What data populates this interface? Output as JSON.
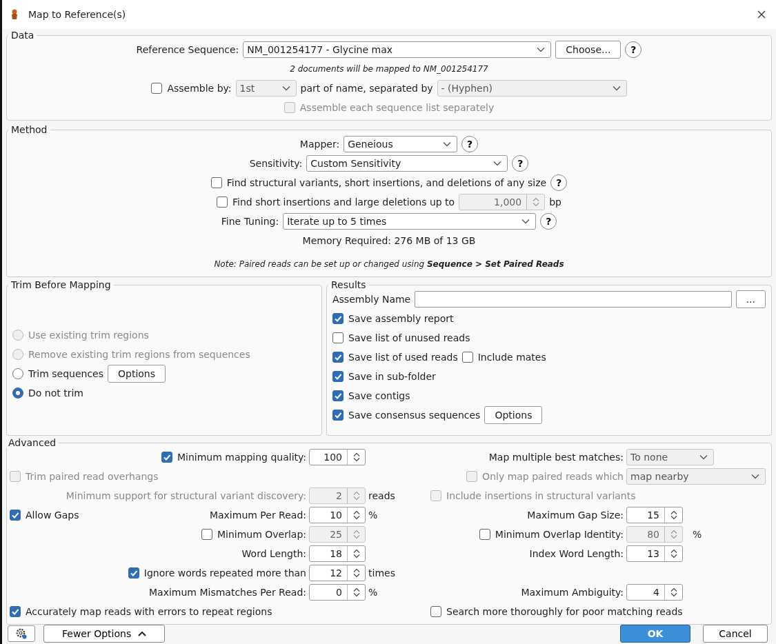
{
  "window": {
    "title": "Map to Reference(s)"
  },
  "data": {
    "title": "Data",
    "rows": [
      {
        "items": [
          {
            "kind": "label",
            "text": "Reference Sequence:"
          },
          {
            "kind": "select",
            "value": "NM_001254177 - Glycine max",
            "disabled": false
          },
          {
            "kind": "button",
            "label": "Choose..."
          },
          {
            "kind": "help",
            "text": "?"
          }
        ]
      },
      {
        "items": [
          {
            "kind": "note",
            "text": "2 documents will be mapped to NM_001254177"
          }
        ]
      },
      {
        "items": [
          {
            "kind": "checkbox",
            "label": "Assemble by:",
            "checked": false,
            "disabled": false
          },
          {
            "kind": "select",
            "value": "1st",
            "disabled": true
          },
          {
            "kind": "label",
            "text": "part of name, separated by"
          },
          {
            "kind": "select",
            "value": "- (Hyphen)",
            "disabled": true
          }
        ]
      },
      {
        "items": [
          {
            "kind": "checkbox",
            "label": "Assemble each sequence list separately",
            "checked": false,
            "disabled": true
          }
        ]
      }
    ]
  },
  "method": {
    "title": "Method",
    "rows": [
      {
        "items": [
          {
            "kind": "label",
            "text": "Mapper:"
          },
          {
            "kind": "select",
            "value": "Geneious",
            "disabled": false
          },
          {
            "kind": "help",
            "text": "?"
          }
        ]
      },
      {
        "items": [
          {
            "kind": "label",
            "text": "Sensitivity:"
          },
          {
            "kind": "select",
            "value": "Custom Sensitivity",
            "disabled": false
          },
          {
            "kind": "help",
            "text": "?"
          }
        ]
      },
      {
        "items": [
          {
            "kind": "checkbox",
            "label": "Find structural variants, short insertions, and deletions of any size",
            "checked": false,
            "disabled": false
          },
          {
            "kind": "help",
            "text": "?"
          }
        ]
      },
      {
        "items": [
          {
            "kind": "checkbox",
            "label": "Find short insertions and large deletions up to",
            "checked": false,
            "disabled": false
          },
          {
            "kind": "spinner",
            "value": "1,000",
            "disabled": true
          },
          {
            "kind": "unit",
            "text": "bp"
          }
        ]
      },
      {
        "items": [
          {
            "kind": "label",
            "text": "Fine Tuning:"
          },
          {
            "kind": "select",
            "value": "Iterate up to 5 times",
            "disabled": false
          },
          {
            "kind": "help",
            "text": "?"
          }
        ]
      },
      {
        "items": [
          {
            "kind": "text",
            "text": "Memory Required: 276 MB of 13 GB"
          }
        ]
      },
      {
        "items": [
          {
            "kind": "note",
            "text": "Note: Paired reads can be set up or changed using **Sequence > Set Paired Reads**"
          }
        ]
      }
    ]
  },
  "trim": {
    "title": "Trim Before Mapping",
    "rows": [
      {
        "items": [
          {
            "kind": "radio",
            "label": "Use existing trim regions",
            "selected": false,
            "disabled": true
          }
        ]
      },
      {
        "items": [
          {
            "kind": "radio",
            "label": "Remove existing trim regions from sequences",
            "selected": false,
            "disabled": true
          }
        ]
      },
      {
        "items": [
          {
            "kind": "radio",
            "label": "Trim sequences",
            "selected": false,
            "disabled": false
          },
          {
            "kind": "button",
            "label": "Options"
          }
        ]
      },
      {
        "items": [
          {
            "kind": "radio",
            "label": "Do not trim",
            "selected": true,
            "disabled": false
          }
        ]
      }
    ]
  },
  "results": {
    "title": "Results",
    "rows": [
      {
        "items": [
          {
            "kind": "label",
            "text": "Assembly Name"
          },
          {
            "kind": "field"
          },
          {
            "kind": "button",
            "label": "..."
          }
        ]
      },
      {
        "items": [
          {
            "kind": "checkbox",
            "label": "Save assembly report",
            "checked": true,
            "disabled": false
          }
        ]
      },
      {
        "items": [
          {
            "kind": "checkbox",
            "label": "Save list of unused reads",
            "checked": false,
            "disabled": false
          }
        ]
      },
      {
        "items": [
          {
            "kind": "checkbox",
            "label": "Save list of used reads",
            "checked": true,
            "disabled": false
          },
          {
            "kind": "checkbox",
            "label": "Include mates",
            "checked": false,
            "disabled": false
          }
        ]
      },
      {
        "items": [
          {
            "kind": "checkbox",
            "label": "Save in sub-folder",
            "checked": true,
            "disabled": false
          }
        ]
      },
      {
        "items": [
          {
            "kind": "checkbox",
            "label": "Save contigs",
            "checked": true,
            "disabled": false
          }
        ]
      },
      {
        "items": [
          {
            "kind": "checkbox",
            "label": "Save consensus sequences",
            "checked": true,
            "disabled": false
          },
          {
            "kind": "button",
            "label": "Options"
          }
        ]
      }
    ]
  },
  "advanced": {
    "title": "Advanced",
    "rows": [
      {
        "left": [
          {
            "kind": "checkbox",
            "label": "Minimum mapping quality:",
            "checked": true,
            "disabled": false
          },
          {
            "kind": "spinner",
            "value": "100",
            "disabled": false
          }
        ],
        "right": [
          {
            "kind": "label",
            "text": "Map multiple best matches:",
            "disabled": false
          },
          {
            "kind": "select",
            "value": "To none",
            "disabled": true
          }
        ]
      },
      {
        "left": [
          {
            "kind": "checkbox",
            "label": "Trim paired read overhangs",
            "checked": false,
            "disabled": true
          }
        ],
        "right": [
          {
            "kind": "checkbox",
            "label": "Only map paired reads which",
            "checked": false,
            "disabled": true
          },
          {
            "kind": "select",
            "value": "map nearby",
            "disabled": true
          }
        ]
      },
      {
        "left": [
          {
            "kind": "label",
            "text": "Minimum support for structural variant discovery:",
            "disabled": true
          },
          {
            "kind": "spinner",
            "value": "2",
            "disabled": true
          },
          {
            "kind": "unit",
            "text": "reads"
          }
        ],
        "right": [
          {
            "kind": "checkbox",
            "label": "Include insertions in structural variants",
            "checked": false,
            "disabled": true
          }
        ]
      },
      {
        "left": [
          {
            "kind": "checkbox",
            "label": "Allow Gaps",
            "checked": true,
            "disabled": false
          },
          {
            "kind": "label",
            "text": "Maximum Per Read:",
            "disabled": false
          },
          {
            "kind": "spinner",
            "value": "10",
            "disabled": false
          },
          {
            "kind": "unit",
            "text": "%"
          }
        ],
        "right": [
          {
            "kind": "label",
            "text": "Maximum Gap Size:",
            "disabled": false
          },
          {
            "kind": "spinner",
            "value": "15",
            "disabled": false
          }
        ]
      },
      {
        "left": [
          {
            "kind": "checkbox",
            "label": "Minimum Overlap:",
            "checked": false,
            "disabled": false
          },
          {
            "kind": "spinner",
            "value": "25",
            "disabled": true
          }
        ],
        "right": [
          {
            "kind": "checkbox",
            "label": "Minimum Overlap Identity:",
            "checked": false,
            "disabled": false
          },
          {
            "kind": "spinner",
            "value": "80",
            "disabled": true
          },
          {
            "kind": "unit",
            "text": "%"
          }
        ]
      },
      {
        "left": [
          {
            "kind": "label",
            "text": "Word Length:",
            "disabled": false
          },
          {
            "kind": "spinner",
            "value": "18",
            "disabled": false
          }
        ],
        "right": [
          {
            "kind": "label",
            "text": "Index Word Length:",
            "disabled": false
          },
          {
            "kind": "spinner",
            "value": "13",
            "disabled": false
          }
        ]
      },
      {
        "left": [
          {
            "kind": "checkbox",
            "label": "Ignore words repeated more than",
            "checked": true,
            "disabled": false
          },
          {
            "kind": "spinner",
            "value": "12",
            "disabled": false
          },
          {
            "kind": "unit",
            "text": "times"
          }
        ],
        "right": []
      },
      {
        "left": [
          {
            "kind": "label",
            "text": "Maximum Mismatches Per Read:",
            "disabled": false
          },
          {
            "kind": "spinner",
            "value": "0",
            "disabled": false
          },
          {
            "kind": "unit",
            "text": "%"
          }
        ],
        "right": [
          {
            "kind": "label",
            "text": "Maximum Ambiguity:",
            "disabled": false
          },
          {
            "kind": "spinner",
            "value": "4",
            "disabled": false
          }
        ]
      },
      {
        "left": [
          {
            "kind": "checkbox",
            "label": "Accurately map reads with errors to repeat regions",
            "checked": true,
            "disabled": false
          }
        ],
        "right": [
          {
            "kind": "checkbox",
            "label": "Search more thoroughly for poor matching reads",
            "checked": false,
            "disabled": false
          }
        ]
      }
    ]
  },
  "footer": {
    "buttons": [
      {
        "kind": "settings"
      },
      {
        "kind": "toggle",
        "label": "Fewer Options"
      },
      {
        "kind": "primary",
        "label": "OK"
      },
      {
        "kind": "secondary",
        "label": "Cancel"
      }
    ]
  }
}
